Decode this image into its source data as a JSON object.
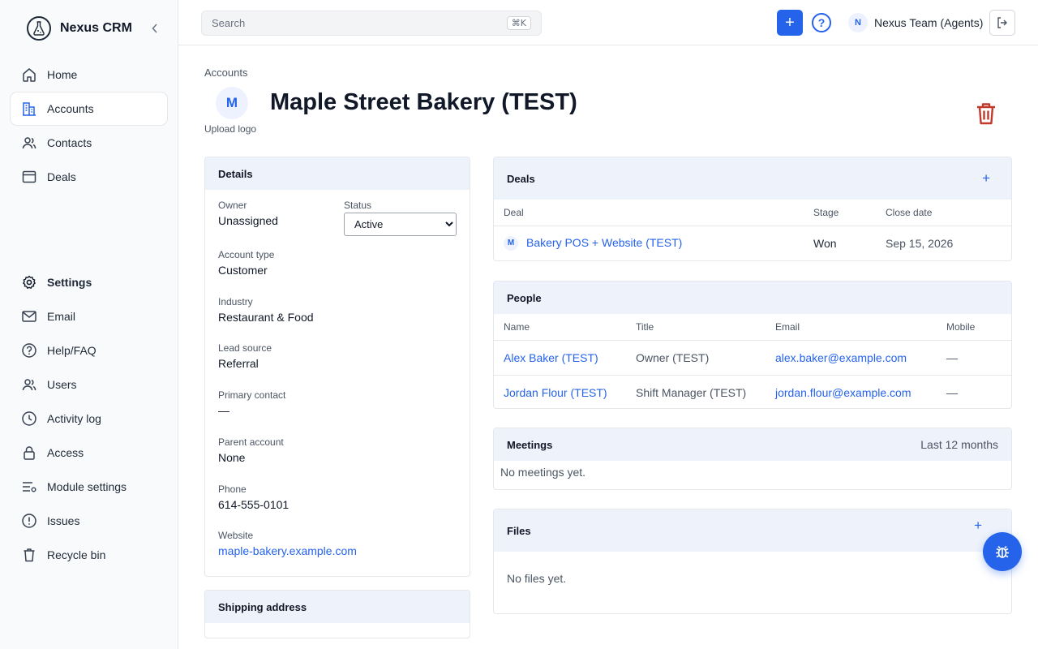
{
  "app": {
    "name": "Nexus CRM"
  },
  "nav_primary": [
    {
      "label": "Home",
      "icon": "home-icon"
    },
    {
      "label": "Accounts",
      "icon": "building-icon",
      "active": true
    },
    {
      "label": "Contacts",
      "icon": "contacts-icon"
    },
    {
      "label": "Deals",
      "icon": "deals-icon"
    }
  ],
  "nav_secondary": [
    {
      "label": "Settings",
      "icon": "settings-icon"
    },
    {
      "label": "Email",
      "icon": "mail-icon"
    },
    {
      "label": "Help/FAQ",
      "icon": "help-icon"
    },
    {
      "label": "Users",
      "icon": "users-icon"
    },
    {
      "label": "Activity log",
      "icon": "clock-icon"
    },
    {
      "label": "Access",
      "icon": "lock-icon"
    },
    {
      "label": "Module settings",
      "icon": "sliders-icon"
    },
    {
      "label": "Issues",
      "icon": "alert-icon"
    },
    {
      "label": "Recycle bin",
      "icon": "trash-icon"
    }
  ],
  "topbar": {
    "search_placeholder": "Search",
    "search_shortcut": "⌘K",
    "add_label": "+",
    "help_label": "?",
    "user_initial": "N",
    "user_name": "Nexus Team (Agents)"
  },
  "account": {
    "breadcrumb": "Accounts",
    "logo_initial": "M",
    "upload_logo": "Upload logo",
    "title": "Maple Street Bakery (TEST)"
  },
  "details": {
    "heading": "Details",
    "owner_label": "Owner",
    "owner_value": "Unassigned",
    "status_label": "Status",
    "status_value": "Active",
    "account_type_label": "Account type",
    "account_type_value": "Customer",
    "industry_label": "Industry",
    "industry_value": "Restaurant & Food",
    "lead_source_label": "Lead source",
    "lead_source_value": "Referral",
    "primary_contact_label": "Primary contact",
    "primary_contact_value": "—",
    "parent_account_label": "Parent account",
    "parent_account_value": "None",
    "phone_label": "Phone",
    "phone_value": "614-555-0101",
    "website_label": "Website",
    "website_value": "maple-bakery.example.com"
  },
  "shipping": {
    "heading": "Shipping address"
  },
  "deals": {
    "heading": "Deals",
    "add_label": "+",
    "columns": [
      "Deal",
      "Stage",
      "Close date"
    ],
    "rows": [
      {
        "initial": "M",
        "name": "Bakery POS + Website (TEST)",
        "stage": "Won",
        "close_date": "Sep 15, 2026"
      }
    ]
  },
  "people": {
    "heading": "People",
    "columns": [
      "Name",
      "Title",
      "Email",
      "Mobile"
    ],
    "rows": [
      {
        "name": "Alex Baker (TEST)",
        "title": "Owner (TEST)",
        "email": "alex.baker@example.com",
        "mobile": "—"
      },
      {
        "name": "Jordan Flour (TEST)",
        "title": "Shift Manager (TEST)",
        "email": "jordan.flour@example.com",
        "mobile": "—"
      }
    ]
  },
  "meetings": {
    "heading": "Meetings",
    "range": "Last 12 months",
    "empty": "No meetings yet."
  },
  "files": {
    "heading": "Files",
    "add_label": "+",
    "empty": "No files yet."
  },
  "colors": {
    "accent": "#2563eb",
    "danger": "#c0392b",
    "panel_header": "#eef2fb"
  }
}
